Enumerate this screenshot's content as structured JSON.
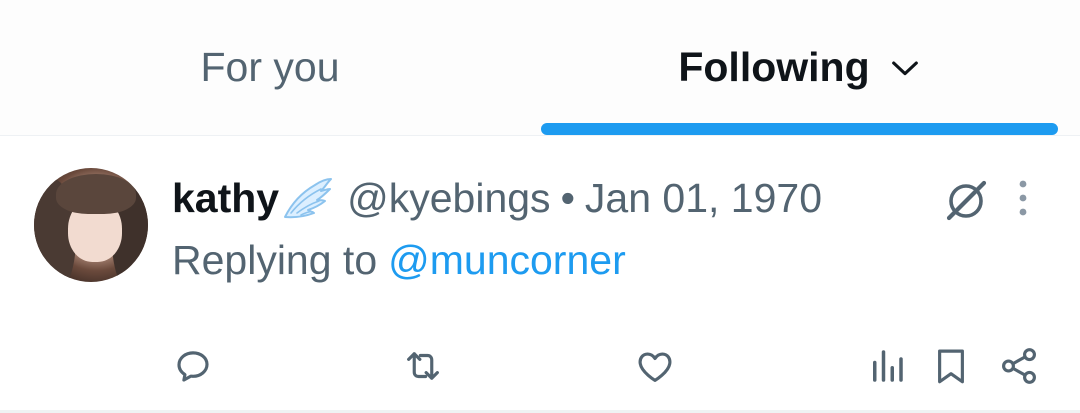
{
  "tabs": {
    "for_you": "For you",
    "following": "Following"
  },
  "tweet": {
    "display_name": "kathy",
    "handle": "@kyebings",
    "separator": "•",
    "date": "Jan 01, 1970",
    "replying_prefix": "Replying to",
    "replying_to": "@muncorner"
  },
  "icons": {
    "badge": "wing-emoji-icon",
    "grok": "grok-icon",
    "more": "more-vertical-icon",
    "reply": "reply-icon",
    "retweet": "retweet-icon",
    "like": "heart-icon",
    "views": "views-icon",
    "bookmark": "bookmark-icon",
    "share": "share-icon",
    "chevron": "chevron-down-icon"
  },
  "colors": {
    "accent": "#1d9bf0",
    "text_primary": "#0f1419",
    "text_secondary": "#536471"
  }
}
